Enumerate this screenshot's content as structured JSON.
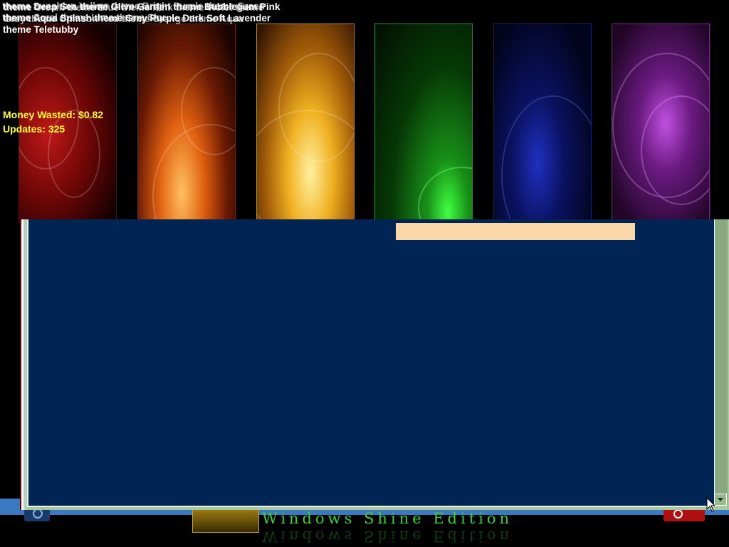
{
  "overlay": {
    "themes_text": "theme Deep Sea theme Olive Garden theme Bubblegum Pink theme Aqua Splash theme Grey Purple Dark Soft Lavender theme Teletubby",
    "ghost_text_1": "theme Cream theme Blue theme Pink theme Violet theme Grey theme Crimson Red theme Orange theme Aqua",
    "ghost_text_2": "theme Sunshine Yellow theme Bright Purple theme Green theme Coral theme Lime theme Sky",
    "money_label": "Money Wasted: $0.82",
    "updates_label": "Updates: 325"
  },
  "taskbar": {
    "start_icon": "start-orb-icon",
    "tray_icon": "power-icon"
  },
  "wallpaper": {
    "brand_text": "Windows Shine Edition"
  },
  "window": {
    "scroll_down_icon": "chevron-down-icon",
    "content_bar_color": "#fad7a6",
    "content_bg": "#002454"
  },
  "colors": {
    "accent_yellow": "#ffff33",
    "taskbar_blue": "#3a78c2",
    "brand_green": "#3cd03c"
  }
}
